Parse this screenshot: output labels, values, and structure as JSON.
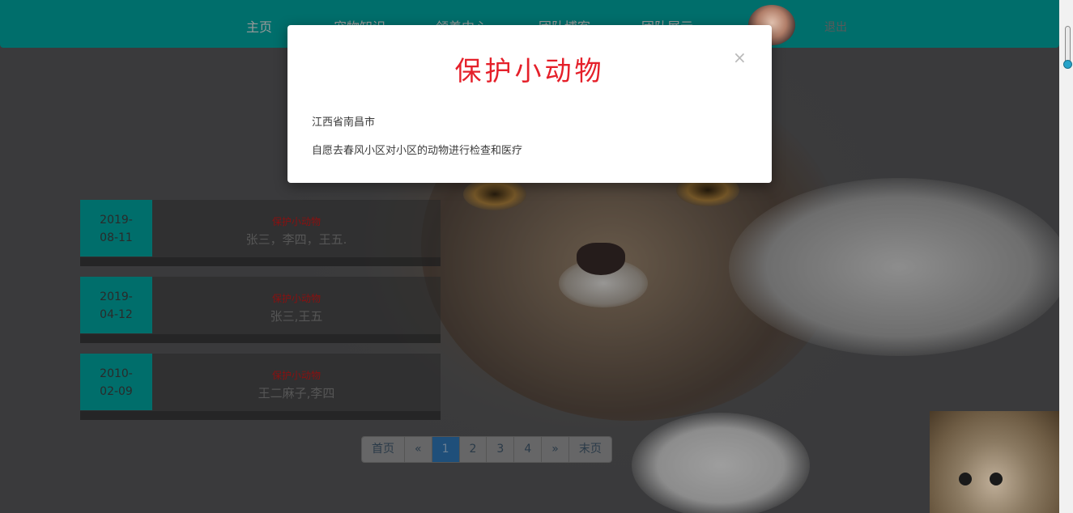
{
  "navbar": {
    "items": [
      "主页",
      "宠物知识",
      "领养中心",
      "团队博客",
      "团队展示"
    ],
    "logout": "退出"
  },
  "activities": [
    {
      "date_line1": "2019-",
      "date_line2": "08-11",
      "title": "保护小动物",
      "people": "张三，李四，王五."
    },
    {
      "date_line1": "2019-",
      "date_line2": "04-12",
      "title": "保护小动物",
      "people": "张三,王五"
    },
    {
      "date_line1": "2010-",
      "date_line2": "02-09",
      "title": "保护小动物",
      "people": "王二麻子,李四"
    }
  ],
  "pagination": {
    "first": "首页",
    "prev": "«",
    "pages": [
      "1",
      "2",
      "3",
      "4"
    ],
    "next": "»",
    "last": "末页",
    "current": "1"
  },
  "modal": {
    "title": "保护小动物",
    "close": "×",
    "location": "江西省南昌市",
    "description": "自愿去春风小区对小区的动物进行检查和医疗"
  },
  "colors": {
    "navbar": "#006e6b",
    "date_box": "#006e6b",
    "modal_title": "#e5202a",
    "activity_title": "#8a1010",
    "active_page": "#1f4f7a"
  },
  "icons": [
    "close-icon",
    "prev-icon",
    "next-icon"
  ]
}
